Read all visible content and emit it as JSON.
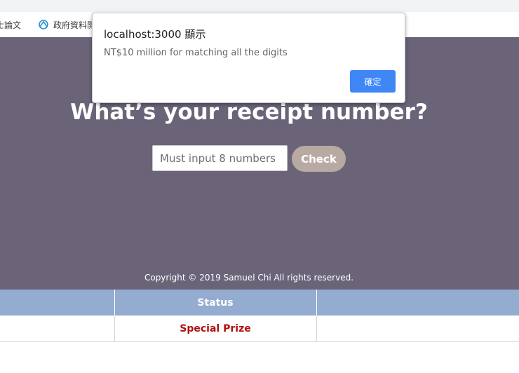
{
  "bookmarks": [
    {
      "label": "士論文",
      "icon": "page-icon"
    },
    {
      "label": "政府資料開",
      "icon": "open-data-icon"
    }
  ],
  "hero": {
    "headline": "What’s your receipt number?",
    "input_placeholder": "Must input 8 numbers",
    "check_label": "Check",
    "copyright": "Copyright © 2019 Samuel Chi All rights reserved."
  },
  "table": {
    "headers": [
      "",
      "Status",
      ""
    ],
    "rows": [
      {
        "cells": [
          "",
          "Special Prize",
          ""
        ]
      }
    ]
  },
  "alert": {
    "title": "localhost:3000 顯示",
    "message": "NT$10 million for matching all the digits",
    "ok_label": "確定"
  },
  "colors": {
    "hero_bg": "#6b6479",
    "check_button": "#b8aaa2",
    "table_header": "#93acd0",
    "prize_text": "#b01010",
    "alert_button": "#3f87f5"
  }
}
